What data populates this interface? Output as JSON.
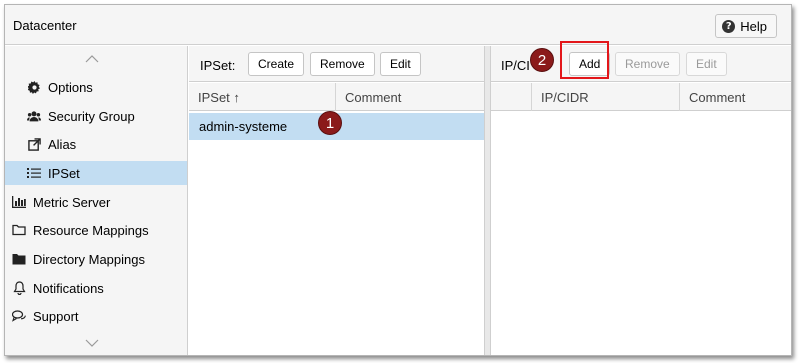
{
  "window": {
    "title": "Datacenter",
    "help_label": "Help"
  },
  "sidebar": {
    "items": [
      {
        "label": "Options",
        "icon": "gear-icon"
      },
      {
        "label": "Security Group",
        "icon": "users-icon"
      },
      {
        "label": "Alias",
        "icon": "external-link-icon"
      },
      {
        "label": "IPSet",
        "icon": "list-icon",
        "selected": true
      },
      {
        "label": "Metric Server",
        "icon": "bar-chart-icon"
      },
      {
        "label": "Resource Mappings",
        "icon": "folder-outline-icon"
      },
      {
        "label": "Directory Mappings",
        "icon": "folder-icon"
      },
      {
        "label": "Notifications",
        "icon": "bell-icon"
      },
      {
        "label": "Support",
        "icon": "comments-icon"
      }
    ]
  },
  "ipset": {
    "toolbar_label": "IPSet:",
    "create_label": "Create",
    "remove_label": "Remove",
    "edit_label": "Edit",
    "columns": [
      "IPSet ↑",
      "Comment"
    ],
    "rows": [
      {
        "name": "admin-systeme",
        "comment": ""
      }
    ]
  },
  "cidr": {
    "toolbar_label": "IP/CI",
    "add_label": "Add",
    "remove_label": "Remove",
    "edit_label": "Edit",
    "columns": [
      "",
      "IP/CIDR",
      "Comment"
    ]
  },
  "annotations": {
    "step1": "1",
    "step2": "2",
    "badge_color": "#8b1a1a",
    "box_color": "#e3161a"
  }
}
